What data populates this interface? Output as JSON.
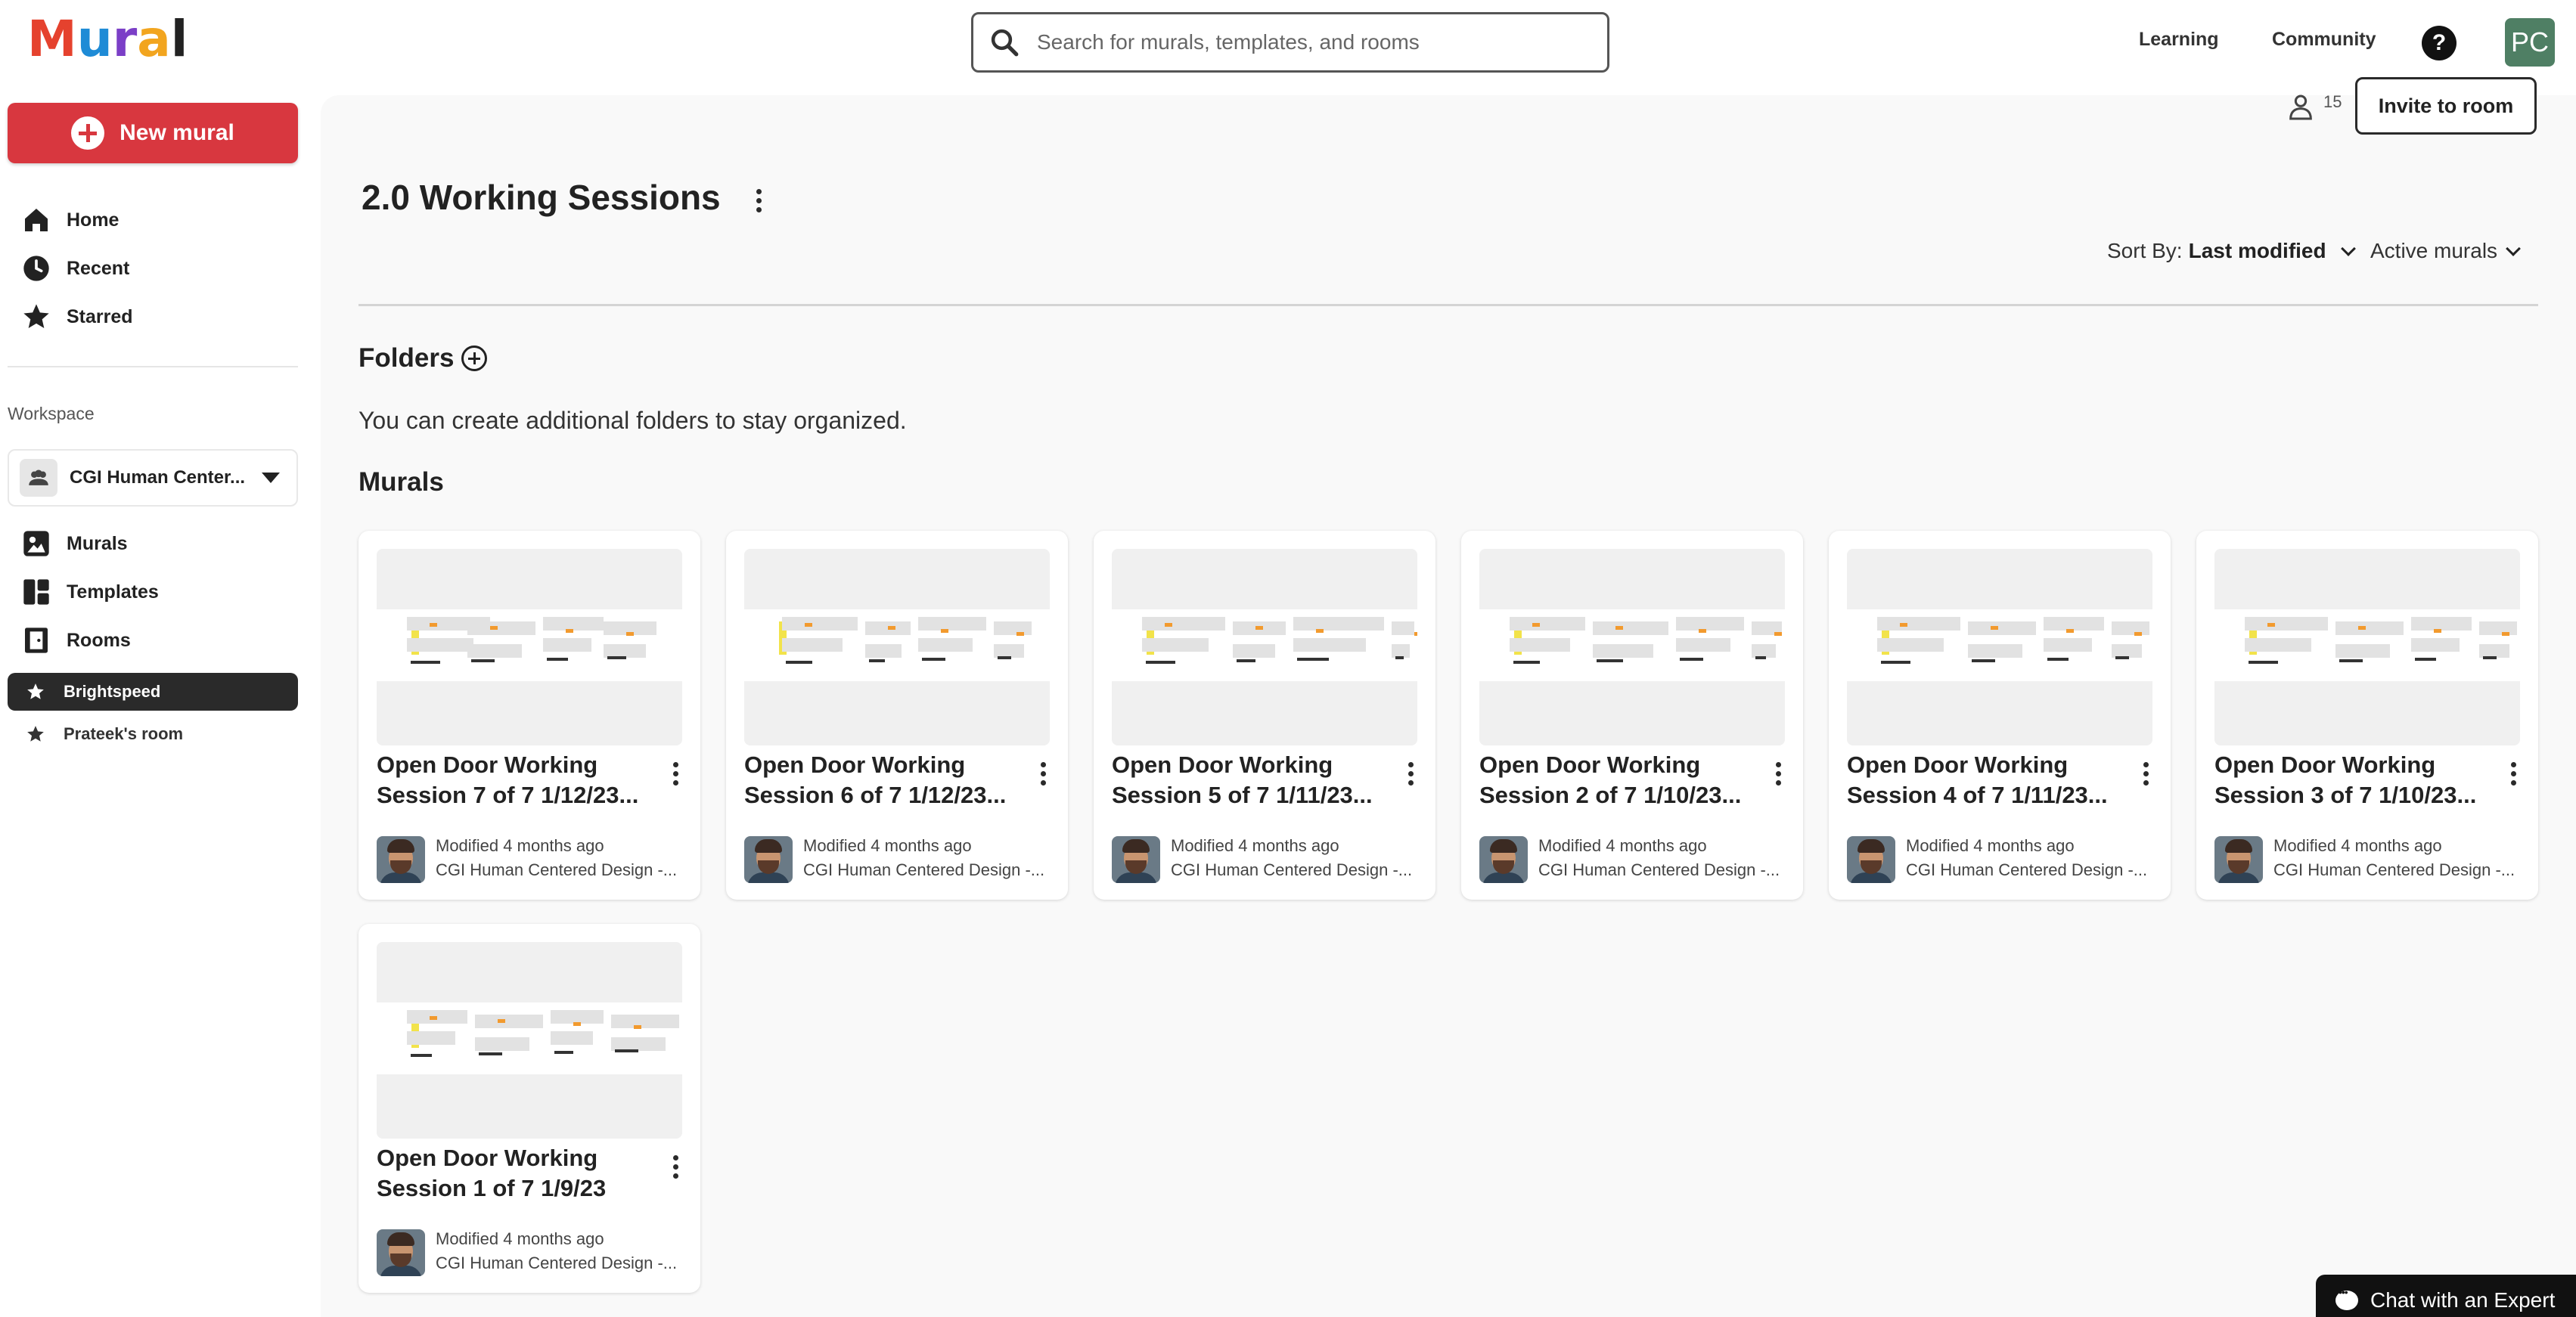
{
  "app": {
    "logo_text": "Mural",
    "logo_colors": [
      "#e5422e",
      "#f2a51f",
      "#1e8bd6",
      "#7b3fc7",
      "#222222"
    ]
  },
  "header": {
    "search_placeholder": "Search for murals, templates, and rooms",
    "links": [
      "Learning",
      "Community"
    ],
    "help_label": "?",
    "user_initials": "PC"
  },
  "sidebar": {
    "new_mural_label": "New mural",
    "nav": [
      {
        "label": "Home",
        "icon": "home-icon"
      },
      {
        "label": "Recent",
        "icon": "clock-icon"
      },
      {
        "label": "Starred",
        "icon": "star-icon"
      }
    ],
    "workspace_label": "Workspace",
    "workspace_name": "CGI Human Center...",
    "sections": [
      {
        "label": "Murals",
        "icon": "murals-icon"
      },
      {
        "label": "Templates",
        "icon": "templates-icon"
      },
      {
        "label": "Rooms",
        "icon": "rooms-icon"
      }
    ],
    "rooms": [
      {
        "label": "Brightspeed",
        "active": true
      },
      {
        "label": "Prateek's room",
        "active": false
      }
    ]
  },
  "room": {
    "member_count": "15",
    "invite_label": "Invite to room",
    "title": "2.0 Working Sessions",
    "sort_prefix": "Sort By:",
    "sort_value": "Last modified",
    "filter_value": "Active murals",
    "folders_heading": "Folders",
    "folders_message": "You can create additional folders to stay organized.",
    "murals_heading": "Murals"
  },
  "murals": [
    {
      "title": "Open Door Working Session 7 of 7 1/12/23...",
      "modified": "Modified 4 months ago",
      "workspace": "CGI Human Centered Design -..."
    },
    {
      "title": "Open Door Working Session 6 of 7 1/12/23...",
      "modified": "Modified 4 months ago",
      "workspace": "CGI Human Centered Design -..."
    },
    {
      "title": "Open Door Working Session 5 of 7 1/11/23...",
      "modified": "Modified 4 months ago",
      "workspace": "CGI Human Centered Design -..."
    },
    {
      "title": "Open Door Working Session 2 of 7 1/10/23...",
      "modified": "Modified 4 months ago",
      "workspace": "CGI Human Centered Design -..."
    },
    {
      "title": "Open Door Working Session 4 of 7 1/11/23...",
      "modified": "Modified 4 months ago",
      "workspace": "CGI Human Centered Design -..."
    },
    {
      "title": "Open Door Working Session 3 of 7 1/10/23...",
      "modified": "Modified 4 months ago",
      "workspace": "CGI Human Centered Design -..."
    },
    {
      "title": "Open Door Working Session 1 of 7 1/9/23",
      "modified": "Modified 4 months ago",
      "workspace": "CGI Human Centered Design -..."
    }
  ],
  "chat": {
    "label": "Chat with an Expert"
  },
  "colors": {
    "accent": "#d8373f",
    "active_room": "#2a2a2a",
    "avatar_bg": "#4f7f64"
  }
}
